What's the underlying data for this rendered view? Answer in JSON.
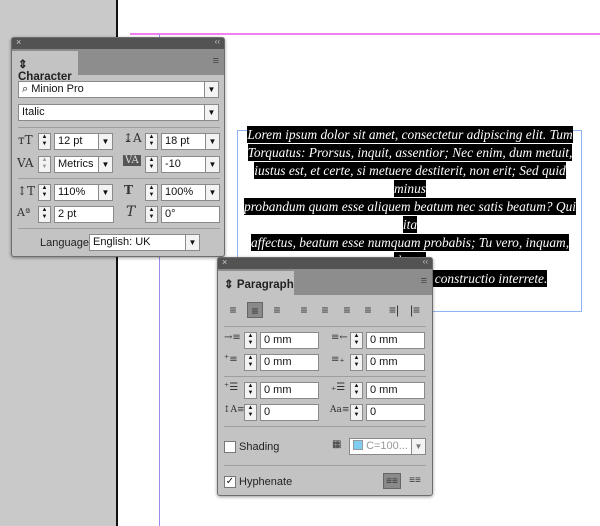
{
  "text_frame": {
    "lines": [
      "Lorem ipsum dolor sit amet, consectetur adipiscing elit. Tum",
      "Torquatus: Prorsus, inquit, assentior; Nec enim, dum metuit,",
      "iustus est, et certe, si metuere destiterit, non erit; Sed quid minus",
      "probandum quam esse aliquem beatum nec satis beatum? Qui ita",
      "affectus, beatum esse numquam probabis; Tu vero, inquam, ducas",
      "licet, si sequetur; Duo Reges: constructio interrete."
    ]
  },
  "character": {
    "title": "Character",
    "font_family": "Minion Pro",
    "font_style": "Italic",
    "font_size": "12 pt",
    "leading": "18 pt",
    "kerning": "Metrics",
    "tracking": "-10",
    "vertical_scale": "110%",
    "horizontal_scale": "100%",
    "baseline_shift": "2 pt",
    "skew": "0°",
    "language_label": "Language:",
    "language": "English: UK"
  },
  "paragraph": {
    "title": "Paragraph",
    "left_indent": "0 mm",
    "right_indent": "0 mm",
    "first_line_indent": "0 mm",
    "last_line_indent": "0 mm",
    "space_before": "0 mm",
    "space_after": "0 mm",
    "drop_cap_lines": "0",
    "drop_cap_chars": "0",
    "shading_label": "Shading",
    "shading_checked": false,
    "shading_color": "C=100...",
    "shading_swatch": "#7fcdf0",
    "hyphenate_label": "Hyphenate",
    "hyphenate_checked": true,
    "alignment_selected": "align-center"
  },
  "icons": {
    "close": "×",
    "collapse": "‹‹",
    "menu": "≡",
    "dropdown": "▼"
  }
}
